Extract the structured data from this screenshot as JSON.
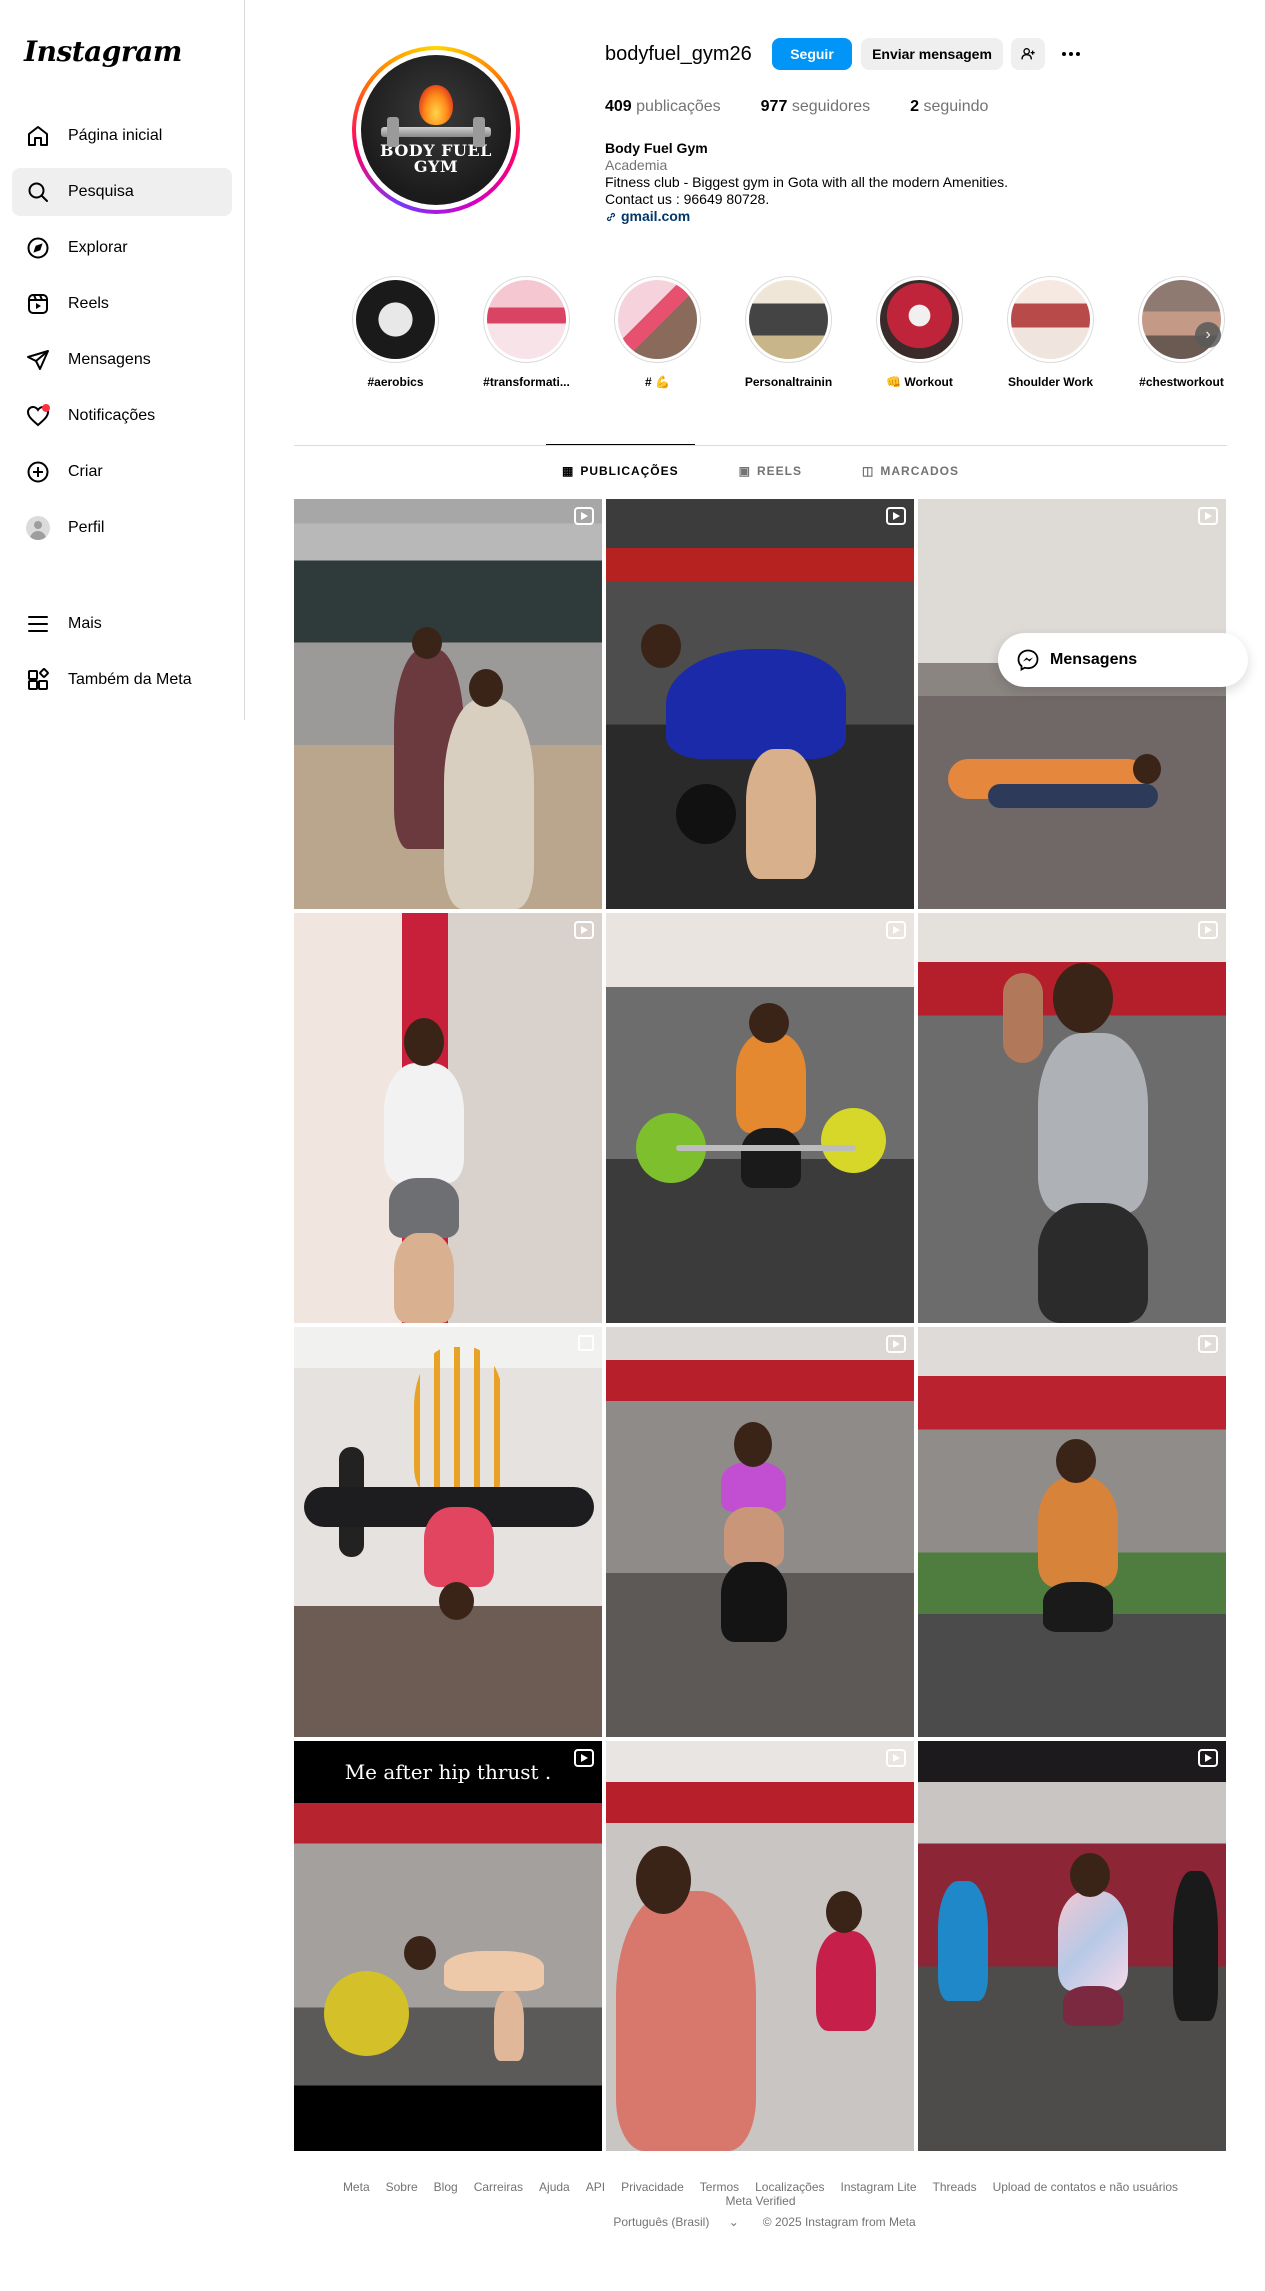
{
  "app": {
    "logo": "Instagram"
  },
  "sidebar": {
    "items": [
      {
        "label": "Página inicial",
        "icon": "home-icon"
      },
      {
        "label": "Pesquisa",
        "icon": "search-icon",
        "active": true
      },
      {
        "label": "Explorar",
        "icon": "compass-icon"
      },
      {
        "label": "Reels",
        "icon": "reels-icon"
      },
      {
        "label": "Mensagens",
        "icon": "send-icon"
      },
      {
        "label": "Notificações",
        "icon": "heart-icon"
      },
      {
        "label": "Criar",
        "icon": "plus-square-icon"
      },
      {
        "label": "Perfil",
        "icon": "avatar"
      }
    ],
    "more": {
      "label": "Mais",
      "icon": "menu-icon"
    },
    "meta": {
      "label": "Também da Meta",
      "icon": "meta-apps-icon"
    }
  },
  "profile": {
    "username": "bodyfuel_gym26",
    "pic_text_line1": "BODY FUEL",
    "pic_text_line2": "GYM",
    "follow_label": "Seguir",
    "message_label": "Enviar mensagem",
    "stats": {
      "posts_value": "409",
      "posts_label": "publicações",
      "followers_value": "977",
      "followers_label": "seguidores",
      "following_value": "2",
      "following_label": "seguindo"
    },
    "bio": {
      "name": "Body Fuel Gym",
      "category": "Academia",
      "line1": "Fitness club - Biggest gym in Gota with all the modern Amenities.",
      "line2": "Contact us : 96649 80728.",
      "link": "gmail.com"
    }
  },
  "highlights": [
    {
      "label": "#aerobics"
    },
    {
      "label": "#transformati..."
    },
    {
      "label": "# 💪"
    },
    {
      "label": "Personaltrainin"
    },
    {
      "label": "👊 Workout"
    },
    {
      "label": "Shoulder Work"
    },
    {
      "label": "#chestworkout"
    }
  ],
  "tabs": [
    {
      "label": "PUBLICAÇÕES",
      "active": true
    },
    {
      "label": "REELS"
    },
    {
      "label": "MARCADOS"
    }
  ],
  "posts": [
    {
      "type": "reel"
    },
    {
      "type": "reel"
    },
    {
      "type": "reel"
    },
    {
      "type": "reel"
    },
    {
      "type": "reel"
    },
    {
      "type": "reel"
    },
    {
      "type": "carousel"
    },
    {
      "type": "reel"
    },
    {
      "type": "reel"
    },
    {
      "type": "reel",
      "caption": "Me after hip thrust ."
    },
    {
      "type": "reel"
    },
    {
      "type": "reel"
    }
  ],
  "floating_messages": {
    "label": "Mensagens"
  },
  "footer": {
    "links": [
      "Meta",
      "Sobre",
      "Blog",
      "Carreiras",
      "Ajuda",
      "API",
      "Privacidade",
      "Termos",
      "Localizações",
      "Instagram Lite",
      "Threads",
      "Upload de contatos e não usuários",
      "Meta Verified"
    ],
    "language": "Português (Brasil)",
    "copyright": "© 2025 Instagram from Meta"
  }
}
